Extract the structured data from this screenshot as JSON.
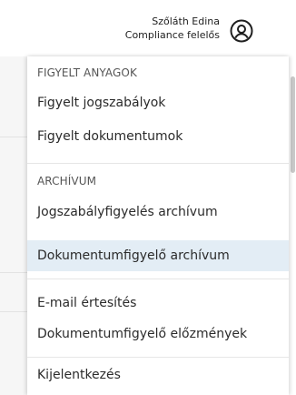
{
  "header": {
    "user_name": "Szőláth Edina",
    "user_role": "Compliance felelős",
    "avatar_icon": "user-circle-icon"
  },
  "menu": {
    "sections": [
      {
        "title": "FIGYELT ANYAGOK",
        "items": [
          {
            "label": "Figyelt jogszabályok"
          },
          {
            "label": "Figyelt dokumentumok"
          }
        ]
      },
      {
        "title": "ARCHÍVUM",
        "items": [
          {
            "label": "Jogszabályfigyelés archívum"
          },
          {
            "label": "Dokumentumfigyelő archívum"
          }
        ]
      },
      {
        "title": "",
        "items": [
          {
            "label": "E-mail értesítés"
          },
          {
            "label": "Dokumentumfigyelő előzmények"
          }
        ]
      },
      {
        "title": "",
        "items": [
          {
            "label": "Kijelentkezés"
          }
        ]
      }
    ],
    "active_item": "Dokumentumfigyelő archívum",
    "active_color": "#e3edf5"
  }
}
